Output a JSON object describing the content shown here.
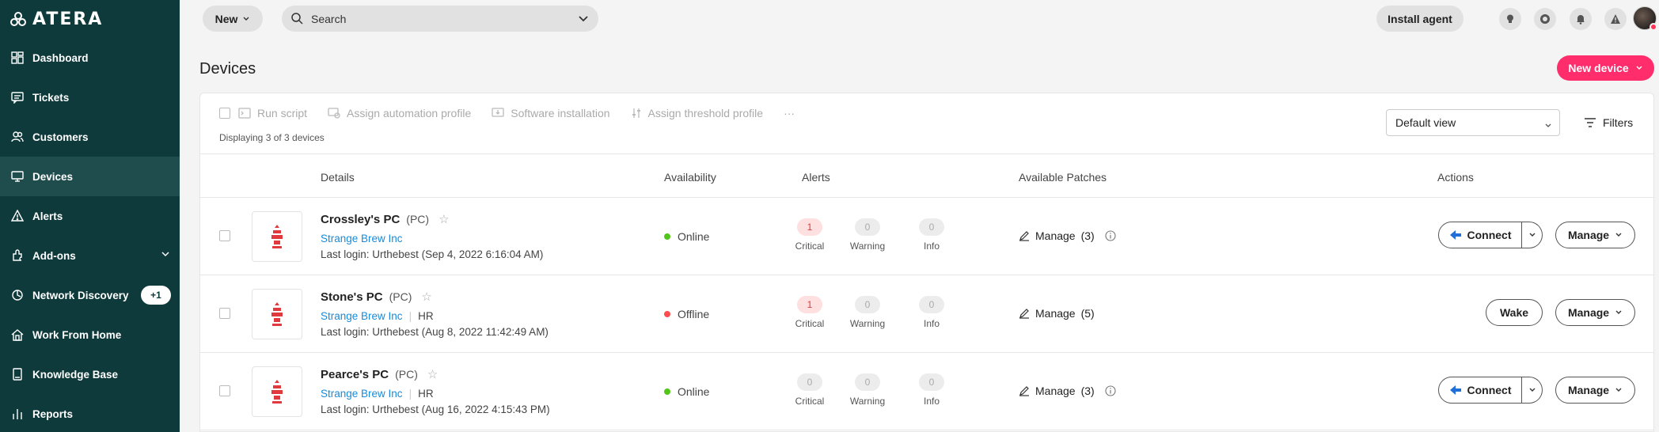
{
  "app": {
    "logo_text": "ATERA"
  },
  "sidebar": {
    "items": [
      {
        "label": "Dashboard",
        "icon": "dashboard-icon"
      },
      {
        "label": "Tickets",
        "icon": "tickets-icon"
      },
      {
        "label": "Customers",
        "icon": "customers-icon"
      },
      {
        "label": "Devices",
        "icon": "devices-icon",
        "active": true
      },
      {
        "label": "Alerts",
        "icon": "alerts-icon"
      },
      {
        "label": "Add-ons",
        "icon": "addons-icon"
      },
      {
        "label": "Network Discovery",
        "icon": "network-discovery-icon",
        "badge": "+1"
      },
      {
        "label": "Work From Home",
        "icon": "home-icon"
      },
      {
        "label": "Knowledge Base",
        "icon": "knowledge-base-icon"
      },
      {
        "label": "Reports",
        "icon": "reports-icon"
      }
    ]
  },
  "topbar": {
    "new_label": "New",
    "search_placeholder": "Search",
    "install_agent_label": "Install agent"
  },
  "page": {
    "title": "Devices",
    "new_device_label": "New device"
  },
  "toolbar": {
    "actions": [
      "Run script",
      "Assign automation profile",
      "Software installation",
      "Assign threshold profile"
    ],
    "more": "···",
    "displaying": "Displaying 3 of 3 devices",
    "view_select": "Default view",
    "filters_label": "Filters"
  },
  "table": {
    "headers": {
      "details": "Details",
      "availability": "Availability",
      "alerts": "Alerts",
      "patches": "Available Patches",
      "actions": "Actions"
    },
    "alert_labels": {
      "critical": "Critical",
      "warning": "Warning",
      "info": "Info"
    },
    "rows": [
      {
        "name": "Crossley's PC",
        "type": "(PC)",
        "customer": "Strange Brew Inc",
        "group": "",
        "last_login": "Last login: Urthebest (Sep 4, 2022 6:16:04 AM)",
        "availability": "Online",
        "alerts": {
          "critical": "1",
          "warning": "0",
          "info": "0"
        },
        "patch_label": "Manage",
        "patch_count": "(3)",
        "primary_action": "Connect",
        "manage_label": "Manage"
      },
      {
        "name": "Stone's PC",
        "type": "(PC)",
        "customer": "Strange Brew Inc",
        "group": "HR",
        "last_login": "Last login: Urthebest (Aug 8, 2022 11:42:49 AM)",
        "availability": "Offline",
        "alerts": {
          "critical": "1",
          "warning": "0",
          "info": "0"
        },
        "patch_label": "Manage",
        "patch_count": "(5)",
        "primary_action": "Wake",
        "manage_label": "Manage"
      },
      {
        "name": "Pearce's PC",
        "type": "(PC)",
        "customer": "Strange Brew Inc",
        "group": "HR",
        "last_login": "Last login: Urthebest (Aug 16, 2022 4:15:43 PM)",
        "availability": "Online",
        "alerts": {
          "critical": "0",
          "warning": "0",
          "info": "0"
        },
        "patch_label": "Manage",
        "patch_count": "(3)",
        "primary_action": "Connect",
        "manage_label": "Manage"
      }
    ]
  },
  "colors": {
    "sidebar_bg": "#0f3a3b",
    "accent_pink": "#ff2d6b",
    "online": "#52c41a",
    "offline": "#ff4d4f",
    "link": "#1a8bd8"
  }
}
